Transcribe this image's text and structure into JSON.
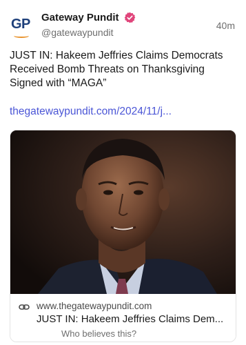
{
  "post": {
    "author_name": "Gateway Pundit",
    "handle": "@gatewaypundit",
    "timestamp": "40m",
    "avatar_text": "GP",
    "text": "JUST IN: Hakeem Jeffries Claims Democrats\nReceived Bomb Threats on Thanksgiving\nSigned with “MAGA”",
    "link_text": "thegatewaypundit.com/2024/11/j..."
  },
  "card": {
    "domain": "www.thegatewaypundit.com",
    "title": "JUST IN: Hakeem Jeffries Claims Dem...",
    "description": "Who believes this?"
  },
  "colors": {
    "link": "#4a55d6",
    "verified": "#e0457b",
    "brand_blue": "#1d3f7a",
    "brand_orange": "#e8922b"
  }
}
